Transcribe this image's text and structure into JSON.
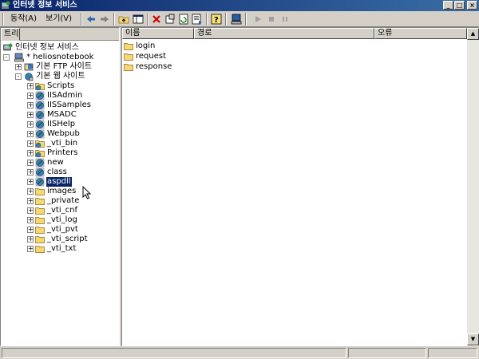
{
  "window": {
    "title": "인터넷 정보 서비스"
  },
  "window_controls": {
    "minimize": "_",
    "maximize": "□",
    "close": "×"
  },
  "menu": [
    "동작(A)",
    "보기(V)"
  ],
  "toolbar_icons": [
    "back-arrow-icon",
    "forward-arrow-icon",
    "up-folder-icon",
    "show-hide-tree-icon",
    "delete-icon",
    "properties-icon",
    "refresh-icon",
    "export-list-icon",
    "help-icon",
    "computer-icon",
    "play-icon",
    "stop-icon",
    "pause-icon"
  ],
  "left_pane": {
    "tab_label": "트리",
    "tree": [
      {
        "label": "인터넷 정보 서비스",
        "depth": 0,
        "icon": "iis-icon",
        "expander": ""
      },
      {
        "label": "* heliosnotebook",
        "depth": 1,
        "icon": "computer-icon",
        "expander": "-"
      },
      {
        "label": "기본 FTP 사이트",
        "depth": 2,
        "icon": "ftp-site-icon",
        "expander": "+"
      },
      {
        "label": "기본 웹 사이트",
        "depth": 2,
        "icon": "web-site-icon",
        "expander": "-"
      },
      {
        "label": "Scripts",
        "depth": 3,
        "icon": "web-folder-icon",
        "expander": "+"
      },
      {
        "label": "IISAdmin",
        "depth": 3,
        "icon": "globe-app-icon",
        "expander": "+"
      },
      {
        "label": "IISSamples",
        "depth": 3,
        "icon": "globe-app-icon",
        "expander": "+"
      },
      {
        "label": "MSADC",
        "depth": 3,
        "icon": "globe-app-icon",
        "expander": "+"
      },
      {
        "label": "IISHelp",
        "depth": 3,
        "icon": "globe-app-icon",
        "expander": "+"
      },
      {
        "label": "Webpub",
        "depth": 3,
        "icon": "globe-app-icon",
        "expander": "+"
      },
      {
        "label": "_vti_bin",
        "depth": 3,
        "icon": "web-folder-icon",
        "expander": "+"
      },
      {
        "label": "Printers",
        "depth": 3,
        "icon": "web-folder-icon",
        "expander": "+"
      },
      {
        "label": "new",
        "depth": 3,
        "icon": "globe-app-icon",
        "expander": "+"
      },
      {
        "label": "class",
        "depth": 3,
        "icon": "globe-app-icon",
        "expander": "+"
      },
      {
        "label": "aspdll",
        "depth": 3,
        "icon": "globe-app-icon",
        "expander": "+",
        "selected": true
      },
      {
        "label": "images",
        "depth": 3,
        "icon": "folder-icon",
        "expander": "+"
      },
      {
        "label": "_private",
        "depth": 3,
        "icon": "folder-icon",
        "expander": "+"
      },
      {
        "label": "_vti_cnf",
        "depth": 3,
        "icon": "folder-icon",
        "expander": "+"
      },
      {
        "label": "_vti_log",
        "depth": 3,
        "icon": "folder-icon",
        "expander": "+"
      },
      {
        "label": "_vti_pvt",
        "depth": 3,
        "icon": "folder-icon",
        "expander": "+"
      },
      {
        "label": "_vti_script",
        "depth": 3,
        "icon": "folder-icon",
        "expander": "+"
      },
      {
        "label": "_vti_txt",
        "depth": 3,
        "icon": "folder-icon",
        "expander": "+"
      }
    ]
  },
  "right_pane": {
    "columns": [
      "이름",
      "경로",
      "오류"
    ],
    "items": [
      {
        "name": "login",
        "icon": "folder-icon"
      },
      {
        "name": "request",
        "icon": "folder-icon"
      },
      {
        "name": "response",
        "icon": "folder-icon"
      }
    ]
  },
  "scrollbar": {
    "up_arrow": "▲",
    "down_arrow": "▼"
  },
  "colors": {
    "titlebar": "#0a246a",
    "selection": "#0a246a",
    "face": "#d4d0c8",
    "folder": "#f7d774"
  }
}
